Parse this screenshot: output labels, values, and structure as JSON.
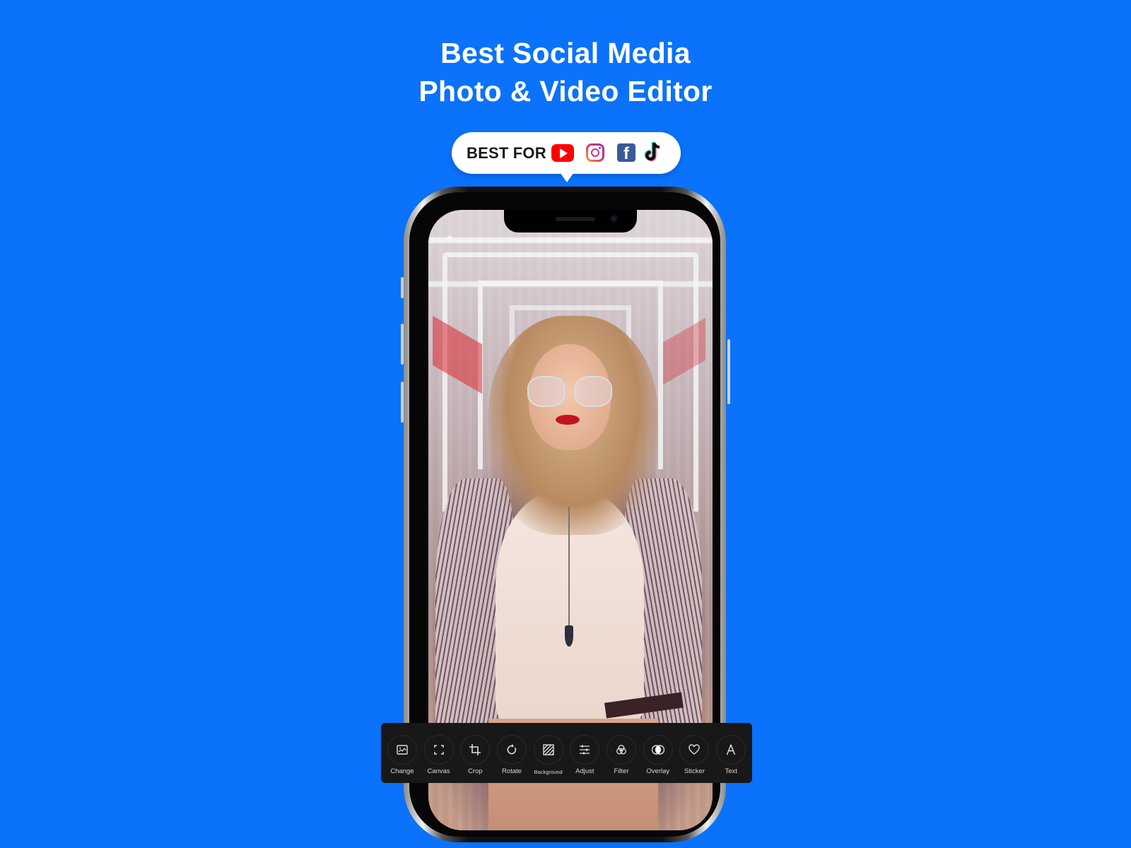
{
  "headline": {
    "line1": "Best Social Media",
    "line2": "Photo & Video Editor"
  },
  "badge": {
    "label": "BEST FOR",
    "platforms": [
      {
        "name": "YouTube",
        "icon": "youtube-icon",
        "color": "#ff0000"
      },
      {
        "name": "Instagram",
        "icon": "instagram-icon",
        "color": "#c13584"
      },
      {
        "name": "Facebook",
        "icon": "facebook-icon",
        "color": "#3b5998"
      },
      {
        "name": "TikTok",
        "icon": "tiktok-icon",
        "color": "#000000"
      }
    ]
  },
  "colors": {
    "background": "#0a72fb",
    "toolbar": "#181818",
    "toolbar_text": "#d8d8d8"
  },
  "toolbar": {
    "tools": [
      {
        "label": "Change",
        "icon": "image-icon"
      },
      {
        "label": "Canvas",
        "icon": "expand-icon"
      },
      {
        "label": "Crop",
        "icon": "crop-icon"
      },
      {
        "label": "Rotate",
        "icon": "rotate-icon"
      },
      {
        "label": "Background",
        "icon": "hatch-pattern-icon"
      },
      {
        "label": "Adjust",
        "icon": "sliders-icon"
      },
      {
        "label": "Filter",
        "icon": "filter-circles-icon"
      },
      {
        "label": "Overlay",
        "icon": "overlay-icon"
      },
      {
        "label": "Sticker",
        "icon": "heart-icon"
      },
      {
        "label": "Text",
        "icon": "text-icon"
      }
    ]
  },
  "fb_glyph": "f"
}
